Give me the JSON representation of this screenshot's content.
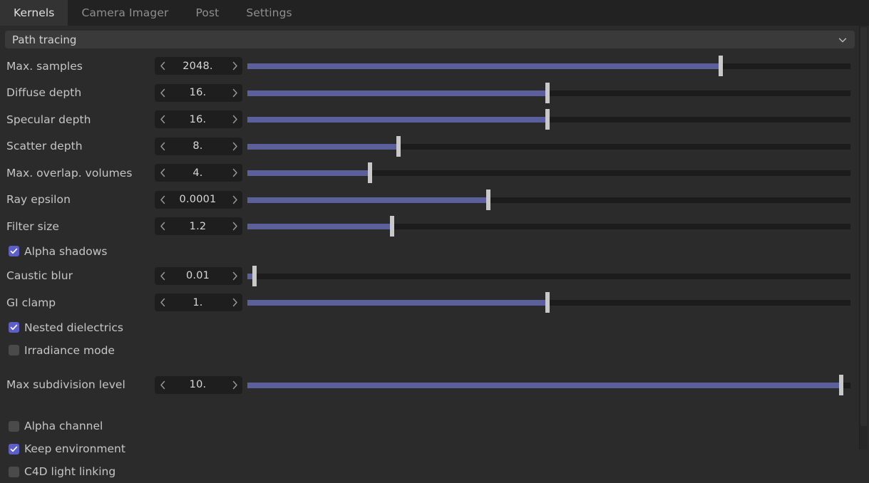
{
  "window": {
    "accent_blue": "#5b5f9b",
    "checkbox_blue": "#5b5fc7",
    "background": "#2b2b2b"
  },
  "tabs": [
    {
      "label": "Kernels",
      "active": true
    },
    {
      "label": "Camera Imager",
      "active": false
    },
    {
      "label": "Post",
      "active": false
    },
    {
      "label": "Settings",
      "active": false
    }
  ],
  "section": {
    "title": "Path tracing",
    "collapse_icon": "chevron-down-icon",
    "expanded": true
  },
  "parameters": [
    {
      "label": "Max. samples",
      "value": "2048.",
      "fill_pct": 78.5,
      "dec_icon": "chevron-left-icon",
      "inc_icon": "chevron-right-icon"
    },
    {
      "label": "Diffuse depth",
      "value": "16.",
      "fill_pct": 49.8,
      "dec_icon": "chevron-left-icon",
      "inc_icon": "chevron-right-icon"
    },
    {
      "label": "Specular depth",
      "value": "16.",
      "fill_pct": 49.8,
      "dec_icon": "chevron-left-icon",
      "inc_icon": "chevron-right-icon"
    },
    {
      "label": "Scatter depth",
      "value": "8.",
      "fill_pct": 25.0,
      "dec_icon": "chevron-left-icon",
      "inc_icon": "chevron-right-icon"
    },
    {
      "label": "Max. overlap. volumes",
      "value": "4.",
      "fill_pct": 20.3,
      "dec_icon": "chevron-left-icon",
      "inc_icon": "chevron-right-icon"
    },
    {
      "label": "Ray epsilon",
      "value": "0.0001",
      "fill_pct": 40.0,
      "dec_icon": "chevron-left-icon",
      "inc_icon": "chevron-right-icon"
    },
    {
      "label": "Filter size",
      "value": "1.2",
      "fill_pct": 24.0,
      "dec_icon": "chevron-left-icon",
      "inc_icon": "chevron-right-icon"
    }
  ],
  "checkbox_alpha_shadows": {
    "label": "Alpha shadows",
    "checked": true
  },
  "parameters2": [
    {
      "label": "Caustic blur",
      "value": "0.01",
      "fill_pct": 1.2,
      "dec_icon": "chevron-left-icon",
      "inc_icon": "chevron-right-icon"
    },
    {
      "label": "GI clamp",
      "value": "1.",
      "fill_pct": 49.8,
      "dec_icon": "chevron-left-icon",
      "inc_icon": "chevron-right-icon"
    }
  ],
  "checkboxes_mid": [
    {
      "label": "Nested dielectrics",
      "checked": true
    },
    {
      "label": "Irradiance mode",
      "checked": false
    }
  ],
  "parameters3": [
    {
      "label": "Max subdivision level",
      "value": "10.",
      "fill_pct": 98.5,
      "dec_icon": "chevron-left-icon",
      "inc_icon": "chevron-right-icon"
    }
  ],
  "checkboxes_bottom": [
    {
      "label": "Alpha channel",
      "checked": false
    },
    {
      "label": "Keep environment",
      "checked": true
    },
    {
      "label": "C4D light linking",
      "checked": false
    }
  ],
  "scrollbar": {
    "name": "vertical-scrollbar"
  }
}
